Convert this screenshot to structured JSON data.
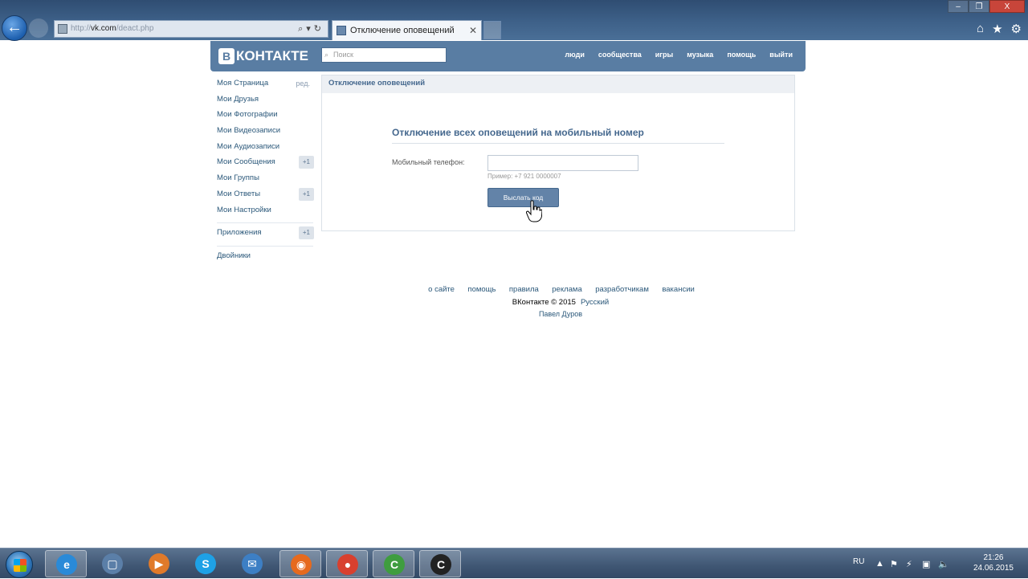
{
  "browser": {
    "url_dim": "http://",
    "url_main": "vk.com",
    "url_rest": "/deact.php",
    "tab_title": "Отключение оповещений",
    "window_buttons": [
      "–",
      "❐",
      "X"
    ]
  },
  "vk_header": {
    "logo_text": "КОНТАКТЕ",
    "logo_letter": "В",
    "search_placeholder": "Поиск",
    "nav": [
      "люди",
      "сообщества",
      "игры",
      "музыка",
      "помощь",
      "выйти"
    ]
  },
  "left_menu": {
    "items": [
      {
        "label": "Моя Страница",
        "extra": "ред."
      },
      {
        "label": "Мои Друзья",
        "extra": ""
      },
      {
        "label": "Мои Фотографии",
        "extra": ""
      },
      {
        "label": "Мои Видеозаписи",
        "extra": ""
      },
      {
        "label": "Мои Аудиозаписи",
        "extra": ""
      },
      {
        "label": "Мои Сообщения",
        "extra": "+1"
      },
      {
        "label": "Мои Группы",
        "extra": ""
      },
      {
        "label": "Мои Ответы",
        "extra": "+1"
      },
      {
        "label": "Мои Настройки",
        "extra": ""
      }
    ],
    "apps": {
      "label": "Приложения",
      "extra": "+1"
    },
    "extra_link": "Двойники"
  },
  "panel": {
    "header": "Отключение оповещений",
    "form_title": "Отключение всех оповещений на мобильный номер",
    "phone_label": "Мобильный телефон:",
    "phone_value": "",
    "hint": "Пример: +7 921 0000007",
    "send_button": "Выслать код"
  },
  "footer": {
    "links": [
      "о сайте",
      "помощь",
      "правила",
      "реклама",
      "разработчикам",
      "вакансии"
    ],
    "copyright": "ВКонтакте © 2015",
    "language": "Русский",
    "author": "Павел Дуров"
  },
  "taskbar": {
    "apps": [
      {
        "name": "ie",
        "letter": "e",
        "color": "#2a8ad8",
        "active": true
      },
      {
        "name": "virtualbox",
        "letter": "▢",
        "color": "#5b7fa8",
        "active": false
      },
      {
        "name": "media",
        "letter": "▶",
        "color": "#e07a2a",
        "active": false
      },
      {
        "name": "skype",
        "letter": "S",
        "color": "#1ea1e6",
        "active": false
      },
      {
        "name": "outlook",
        "letter": "✉",
        "color": "#3d7fc4",
        "active": false
      },
      {
        "name": "firefox",
        "letter": "◉",
        "color": "#e66a1e",
        "active": true
      },
      {
        "name": "chrome",
        "letter": "●",
        "color": "#d8402f",
        "active": true
      },
      {
        "name": "camtasia",
        "letter": "C",
        "color": "#3f9d3f",
        "active": true
      },
      {
        "name": "camtasia-recorder",
        "letter": "C",
        "color": "#222222",
        "active": true
      }
    ],
    "lang": "RU",
    "time": "21:26",
    "date": "24.06.2015"
  }
}
